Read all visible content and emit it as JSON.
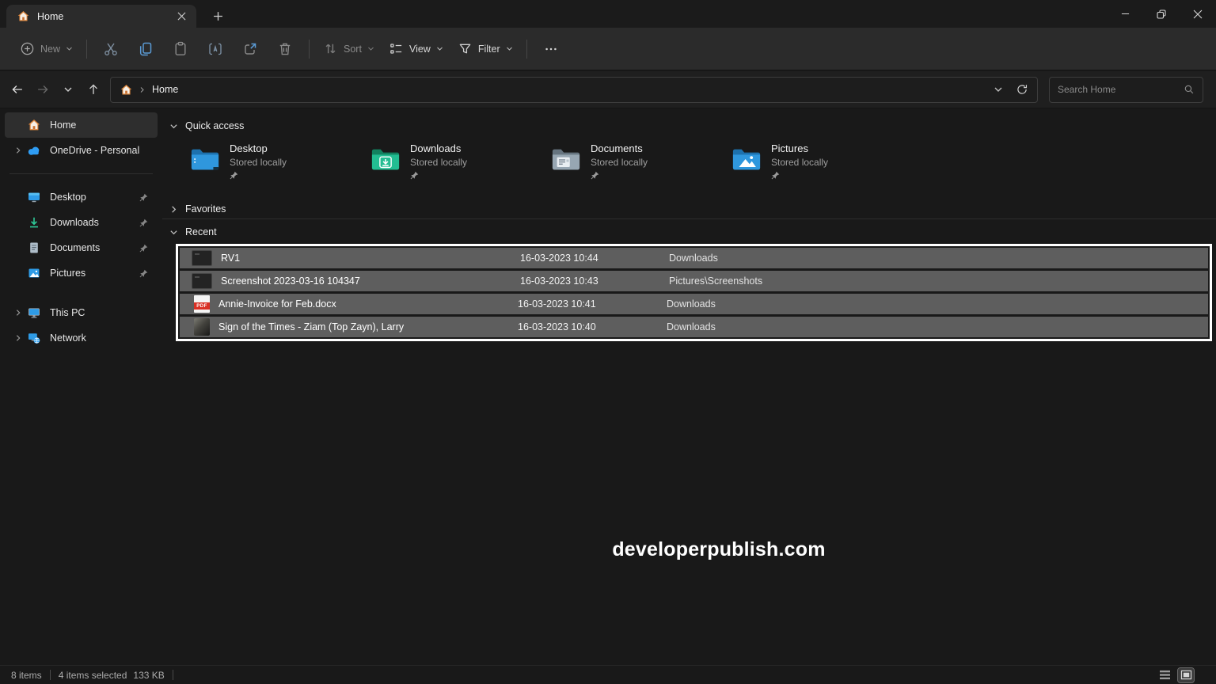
{
  "titlebar": {
    "tab_title": "Home"
  },
  "toolbar": {
    "new_label": "New",
    "sort_label": "Sort",
    "view_label": "View",
    "filter_label": "Filter"
  },
  "address_bar": {
    "breadcrumb_root": "Home",
    "search_placeholder": "Search Home"
  },
  "sidebar": {
    "home": "Home",
    "onedrive": "OneDrive - Personal",
    "pinned": [
      {
        "label": "Desktop"
      },
      {
        "label": "Downloads"
      },
      {
        "label": "Documents"
      },
      {
        "label": "Pictures"
      }
    ],
    "this_pc": "This PC",
    "network": "Network"
  },
  "main": {
    "quick_access_title": "Quick access",
    "cards": [
      {
        "name": "Desktop",
        "subtitle": "Stored locally"
      },
      {
        "name": "Downloads",
        "subtitle": "Stored locally"
      },
      {
        "name": "Documents",
        "subtitle": "Stored locally"
      },
      {
        "name": "Pictures",
        "subtitle": "Stored locally"
      }
    ],
    "favorites_title": "Favorites",
    "recent_title": "Recent",
    "files": [
      {
        "name": "RV1",
        "date": "16-03-2023 10:44",
        "location": "Downloads"
      },
      {
        "name": "Screenshot 2023-03-16 104347",
        "date": "16-03-2023 10:43",
        "location": "Pictures\\Screenshots"
      },
      {
        "name": "Annie-Invoice for Feb.docx",
        "date": "16-03-2023 10:41",
        "location": "Downloads",
        "badge": "PDF"
      },
      {
        "name": "Sign of the Times - Ziam (Top Zayn), Larry",
        "date": "16-03-2023 10:40",
        "location": "Downloads"
      }
    ]
  },
  "watermark": "developerpublish.com",
  "status_bar": {
    "items_count": "8 items",
    "selection_count": "4 items selected",
    "selection_size": "133 KB"
  },
  "colors": {
    "accent_blue": "#5b9bd5",
    "selected_row_bg": "#5e5e5e",
    "highlight_border": "#ffffff",
    "pdf_red": "#d93025",
    "onedrive_blue": "#2f9df4",
    "downloads_green": "#23bd92",
    "folder_blue": "#2f97dd"
  }
}
